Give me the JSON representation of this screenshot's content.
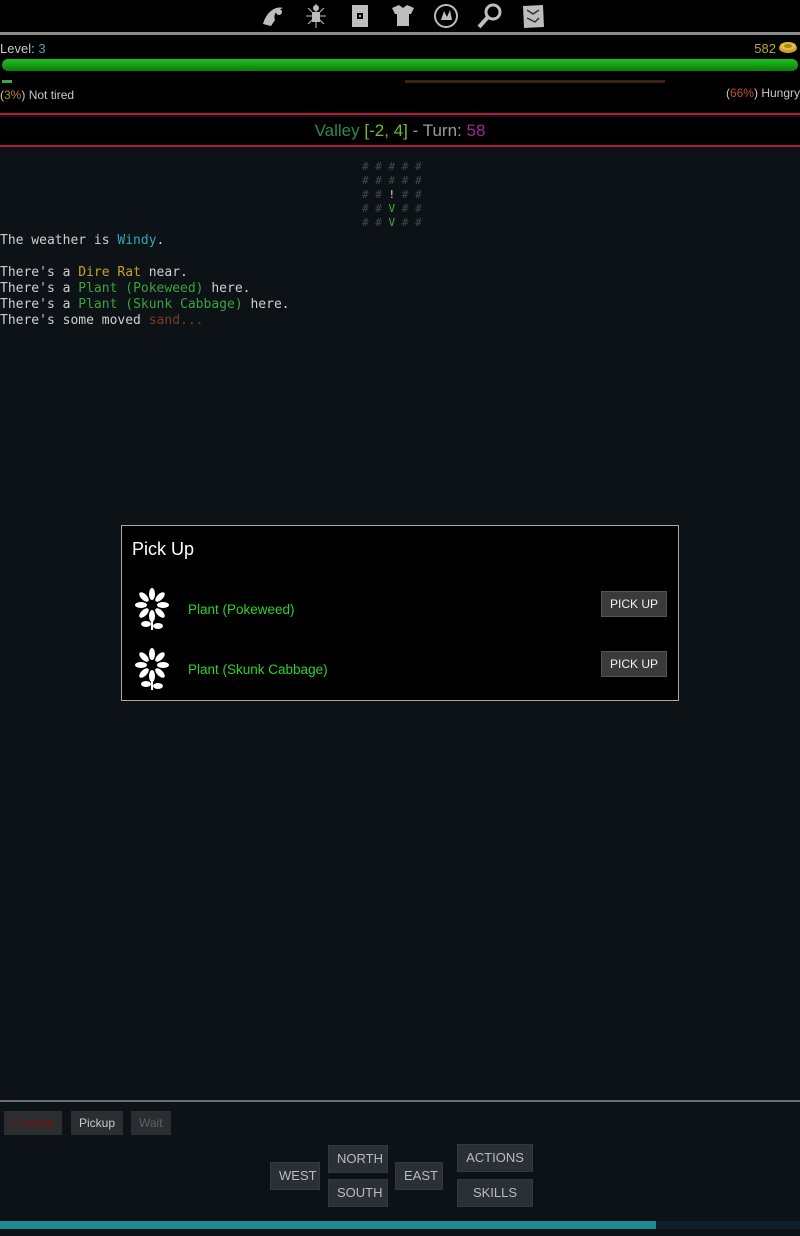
{
  "toolbar": {
    "icons": [
      "character-icon",
      "body-icon",
      "armor-icon",
      "equipment-icon",
      "skills-icon",
      "search-icon",
      "map-icon"
    ]
  },
  "stats": {
    "level_label": "Level:",
    "level_value": "3",
    "gold": "582",
    "health_fill": 1.0,
    "tiredness_pct": "3%",
    "tiredness_label": "Not tired",
    "hunger_pct": "66%",
    "hunger_label": "Hungry"
  },
  "location": {
    "name": "Valley",
    "x": "-2",
    "y": "4",
    "turn_label": "Turn:",
    "turn": "58"
  },
  "minimap": {
    "rows": [
      "# # # # #",
      "# # # # #",
      "# # ! # #",
      "# # V # #",
      "# # V # #"
    ]
  },
  "log": {
    "weather_prefix": "The weather is ",
    "weather": "Windy",
    "line1_prefix": "There's a ",
    "line1_name": "Dire Rat",
    "line1_suffix": " near.",
    "line2_prefix": "There's a ",
    "line2_name": "Plant (Pokeweed)",
    "line2_suffix": " here.",
    "line3_prefix": "There's a ",
    "line3_name": "Plant (Skunk Cabbage)",
    "line3_suffix": " here.",
    "line4_prefix": "There's some moved ",
    "line4_name": "sand..."
  },
  "dialog": {
    "title": "Pick Up",
    "items": [
      {
        "name": "Plant (Pokeweed)",
        "button": "PICK UP"
      },
      {
        "name": "Plant (Skunk Cabbage)",
        "button": "PICK UP"
      }
    ]
  },
  "bottom": {
    "quick": [
      "Combat",
      "Pickup",
      "Wait"
    ],
    "nav": {
      "north": "NORTH",
      "south": "SOUTH",
      "west": "WEST",
      "east": "EAST",
      "actions": "ACTIONS",
      "skills": "SKILLS"
    },
    "progress_fill": 0.82
  },
  "colors": {
    "accent_red": "#b31b2e",
    "health_green": "#1fc21f",
    "item_green": "#28d428",
    "turn_purple": "#a02a8f"
  }
}
